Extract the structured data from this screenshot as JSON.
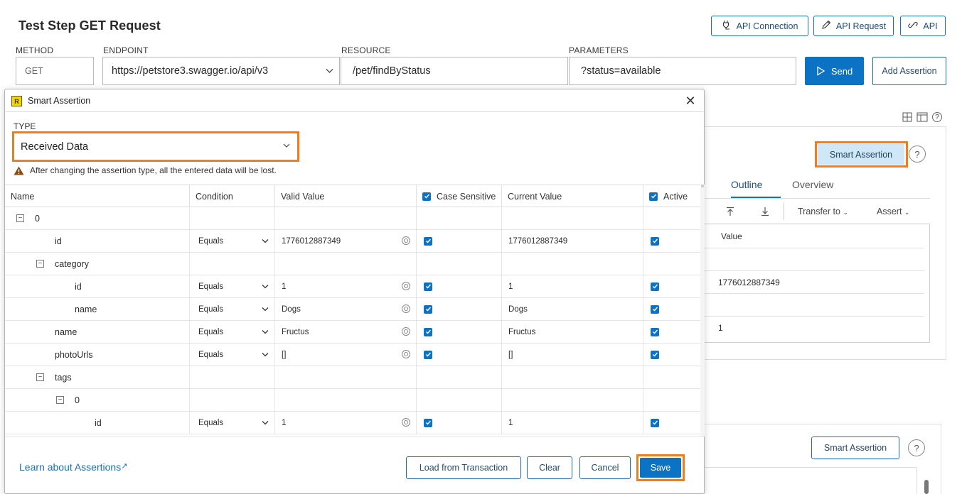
{
  "page": {
    "title": "Test Step GET Request",
    "top_buttons": [
      {
        "label": "API Connection",
        "icon": "plug-icon"
      },
      {
        "label": "API Request",
        "icon": "pencil-icon"
      },
      {
        "label": "API",
        "icon": "link-icon"
      }
    ]
  },
  "request": {
    "method_label": "METHOD",
    "method_value": "GET",
    "endpoint_label": "ENDPOINT",
    "endpoint_value": "https://petstore3.swagger.io/api/v3",
    "resource_label": "RESOURCE",
    "resource_value": "/pet/findByStatus",
    "parameters_label": "PARAMETERS",
    "parameters_value": "?status=available",
    "send_label": "Send",
    "add_assertion_label": "Add Assertion"
  },
  "background": {
    "smart_assertion_label": "Smart Assertion",
    "help_label": "?",
    "tabs": [
      {
        "label": "Outline",
        "active": true
      },
      {
        "label": "Overview",
        "active": false
      }
    ],
    "toolbar": {
      "transfer_to": "Transfer to",
      "assert": "Assert"
    },
    "grid_header": "Value",
    "grid_values": [
      "",
      "1776012887349",
      "",
      "1"
    ],
    "smart_assertion_label_2": "Smart Assertion"
  },
  "dialog": {
    "title": "Smart Assertion",
    "type_label": "TYPE",
    "type_value": "Received Data",
    "warning": "After changing the assertion type, all the entered data will be lost.",
    "columns": {
      "name": "Name",
      "condition": "Condition",
      "valid_value": "Valid Value",
      "case_sensitive": "Case Sensitive",
      "current_value": "Current Value",
      "active": "Active"
    },
    "rows": [
      {
        "name": "0",
        "indent": 0,
        "toggle": "−",
        "condition": "",
        "valid": "",
        "case": false,
        "current": "",
        "active": false
      },
      {
        "name": "id",
        "indent": 1,
        "toggle": "",
        "condition": "Equals",
        "valid": "1776012887349",
        "case": true,
        "current": "1776012887349",
        "active": true
      },
      {
        "name": "category",
        "indent": 1,
        "toggle": "−",
        "condition": "",
        "valid": "",
        "case": false,
        "current": "",
        "active": false
      },
      {
        "name": "id",
        "indent": 2,
        "toggle": "",
        "condition": "Equals",
        "valid": "1",
        "case": true,
        "current": "1",
        "active": true
      },
      {
        "name": "name",
        "indent": 2,
        "toggle": "",
        "condition": "Equals",
        "valid": "Dogs",
        "case": true,
        "current": "Dogs",
        "active": true
      },
      {
        "name": "name",
        "indent": 1,
        "toggle": "",
        "condition": "Equals",
        "valid": "Fructus",
        "case": true,
        "current": "Fructus",
        "active": true
      },
      {
        "name": "photoUrls",
        "indent": 1,
        "toggle": "",
        "condition": "Equals",
        "valid": "[]",
        "case": true,
        "current": "[]",
        "active": true
      },
      {
        "name": "tags",
        "indent": 1,
        "toggle": "−",
        "condition": "",
        "valid": "",
        "case": false,
        "current": "",
        "active": false
      },
      {
        "name": "0",
        "indent": 2,
        "toggle": "−",
        "condition": "",
        "valid": "",
        "case": false,
        "current": "",
        "active": false
      },
      {
        "name": "id",
        "indent": 3,
        "toggle": "",
        "condition": "Equals",
        "valid": "1",
        "case": true,
        "current": "1",
        "active": true
      }
    ],
    "learn_link": "Learn about Assertions",
    "buttons": {
      "load": "Load from Transaction",
      "clear": "Clear",
      "cancel": "Cancel",
      "save": "Save"
    }
  },
  "colors": {
    "accent": "#0b72c4",
    "highlight": "#f07d1a"
  }
}
